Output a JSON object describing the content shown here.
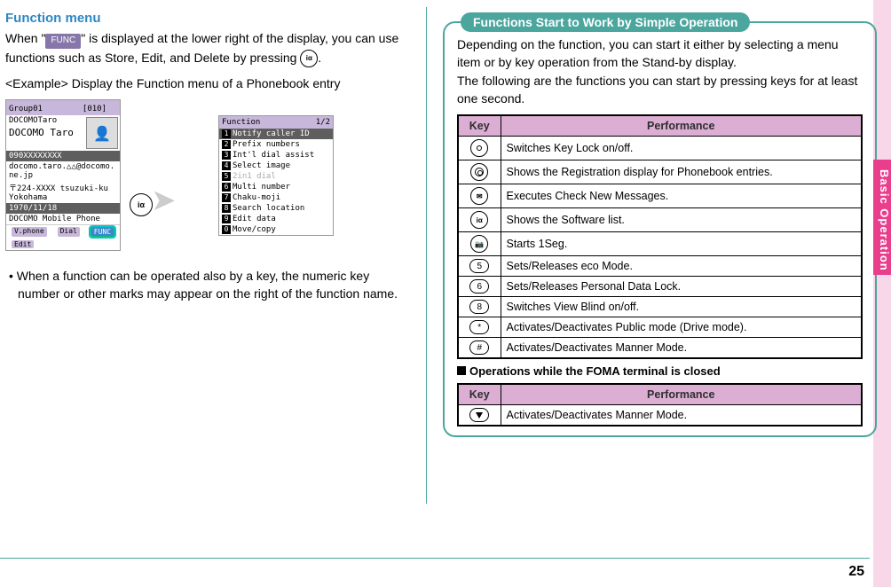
{
  "sideTab": "Basic Operation",
  "pageNumber": "25",
  "left": {
    "title": "Function menu",
    "intro_a": "When \"",
    "intro_func": "FUNC",
    "intro_b": "\" is displayed at the lower right of the display, you can use functions such as Store, Edit, and Delete by pressing ",
    "intro_key": "iα",
    "intro_c": ".",
    "example": "<Example> Display the Function menu of a Phonebook entry",
    "phonebook": {
      "group": "Group01　　　　　[010]",
      "name1": "DOCOMOTaro",
      "name2": "DOCOMO Taro",
      "phone": "090XXXXXXXX",
      "mail": "docomo.taro.△△@docomo.ne.jp",
      "post": "〒224-XXXX tsuzuki-ku Yokohama",
      "bday": "1970/11/18",
      "model": "DOCOMO Mobile Phone",
      "foot": {
        "a": "V.phone",
        "b": "Dial",
        "c": "FUNC",
        "d": "Edit"
      }
    },
    "funcMenu": {
      "head": "Function　　1/2",
      "items": [
        {
          "n": "1",
          "t": "Notify caller ID",
          "hl": true
        },
        {
          "n": "2",
          "t": "Prefix numbers"
        },
        {
          "n": "3",
          "t": "Int'l dial assist"
        },
        {
          "n": "4",
          "t": "Select image"
        },
        {
          "n": "5",
          "t": "2in1 dial",
          "dis": true
        },
        {
          "n": "6",
          "t": "Multi number"
        },
        {
          "n": "7",
          "t": "Chaku-moji"
        },
        {
          "n": "8",
          "t": "Search location"
        },
        {
          "n": "9",
          "t": "Edit data"
        },
        {
          "n": "0",
          "t": "Move/copy"
        }
      ]
    },
    "note": "When a function can be operated also by a key, the numeric key number or other marks may appear on the right of the function name."
  },
  "right": {
    "boxTitle": "Functions Start to Work by Simple Operation",
    "intro": "Depending on the function, you can start it either by selecting a menu item or by key operation from the Stand-by display.\nThe following are the functions you can start by pressing keys for at least one second.",
    "th_key": "Key",
    "th_perf": "Performance",
    "rows": [
      {
        "k": "dot",
        "t": "Switches Key Lock on/off."
      },
      {
        "k": "ring",
        "t": "Shows the Registration display for Phonebook entries."
      },
      {
        "k": "mail",
        "t": "Executes Check New Messages."
      },
      {
        "k": "ia",
        "t": "Shows the Software list."
      },
      {
        "k": "cam",
        "t": "Starts 1Seg."
      },
      {
        "k": "5",
        "t": "Sets/Releases eco Mode."
      },
      {
        "k": "6",
        "t": "Sets/Releases Personal Data Lock."
      },
      {
        "k": "8",
        "t": "Switches View Blind on/off."
      },
      {
        "k": "*",
        "t": "Activates/Deactivates Public mode (Drive mode)."
      },
      {
        "k": "#",
        "t": "Activates/Deactivates Manner Mode."
      }
    ],
    "sub": "Operations while the FOMA terminal is closed",
    "rows2": [
      {
        "k": "down",
        "t": "Activates/Deactivates Manner Mode."
      }
    ]
  }
}
